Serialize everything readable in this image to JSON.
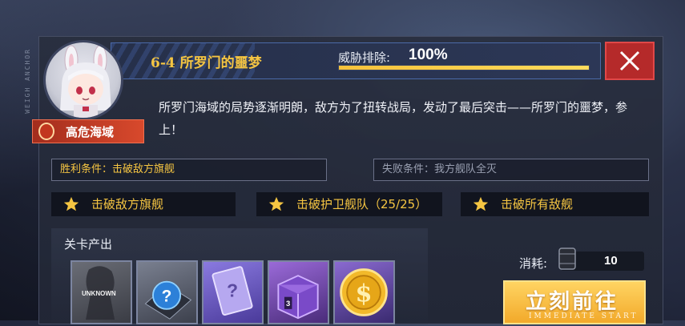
{
  "stage": {
    "title": "6-4 所罗门的噩梦",
    "threat_label": "威胁排除:",
    "threat_value": "100%",
    "threat_progress": 1.0,
    "area_tag": "高危海域",
    "description": "所罗门海域的局势逐渐明朗，敌方为了扭转战局，发动了最后突击——所罗门的噩梦，参上！"
  },
  "conditions": {
    "win": "胜利条件：击破敌方旗舰",
    "lose": "失败条件：我方舰队全灭"
  },
  "star_objectives": [
    {
      "label": "击破敌方旗舰"
    },
    {
      "label": "击破护卫舰队（25/25）"
    },
    {
      "label": "击破所有敌舰"
    }
  ],
  "rewards": {
    "title": "关卡产出",
    "unknown_label": "UNKNOWN",
    "items": [
      "unknown-item",
      "question-box-icon",
      "question-card-icon",
      "equipment-box-icon",
      "gold-coin-icon"
    ]
  },
  "cost": {
    "label": "消耗:",
    "value": "10",
    "icon": "oil-barrel-icon"
  },
  "go_button": {
    "label": "立刻前往",
    "sub": "IMMEDIATE START"
  },
  "side_text": "WEIGH ANCHOR",
  "colors": {
    "accent_gold": "#f5c542",
    "danger_red": "#b52a2a",
    "area_tag_red": "#d8492c",
    "go_button": "#f2a92a"
  }
}
